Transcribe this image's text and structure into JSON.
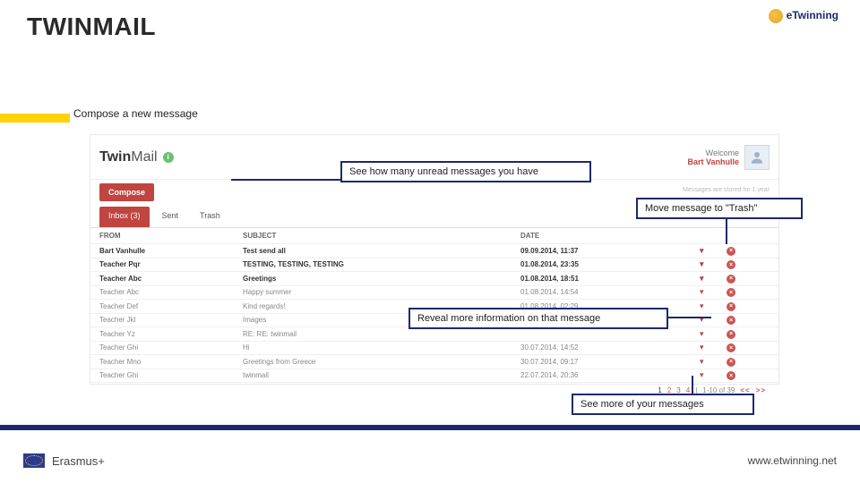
{
  "slide": {
    "title": "TWINMAIL"
  },
  "logo": {
    "text": "eTwinning"
  },
  "captions": {
    "compose": "Compose a new message",
    "unread": "See how many unread messages you have",
    "trash": "Move message to \"Trash\"",
    "reveal": "Reveal more information on that message",
    "seemore": "See more of your messages"
  },
  "app": {
    "title_prefix": "Twin",
    "title_suffix": "Mail",
    "welcome_label": "Welcome",
    "welcome_name": "Bart Vanhulle",
    "compose_label": "Compose",
    "storage_note": "Messages are stored for 1 year",
    "tabs": {
      "inbox": "Inbox (3)",
      "sent": "Sent",
      "trash": "Trash"
    },
    "columns": {
      "from": "FROM",
      "subject": "SUBJECT",
      "date": "DATE"
    },
    "rows": [
      {
        "from": "Bart Vanhulle",
        "subject": "Test send all",
        "date": "09.09.2014, 11:37",
        "bold": true
      },
      {
        "from": "Teacher Pqr",
        "subject": "TESTING, TESTING, TESTING",
        "date": "01.08.2014, 23:35",
        "bold": true
      },
      {
        "from": "Teacher Abc",
        "subject": "Greetings",
        "date": "01.08.2014, 18:51",
        "bold": true
      },
      {
        "from": "Teacher Abc",
        "subject": "Happy summer",
        "date": "01.08.2014, 14:54",
        "bold": false
      },
      {
        "from": "Teacher Def",
        "subject": "Kind regards!",
        "date": "01.08.2014, 02:29",
        "bold": false
      },
      {
        "from": "Teacher Jkl",
        "subject": "Images",
        "date": "",
        "bold": false
      },
      {
        "from": "Teacher Yz",
        "subject": "RE: RE: twinmail",
        "date": "",
        "bold": false
      },
      {
        "from": "Teacher Ghi",
        "subject": "Hi",
        "date": "30.07.2014, 14:52",
        "bold": false
      },
      {
        "from": "Teacher Mno",
        "subject": "Greetings from Greece",
        "date": "30.07.2014, 09:17",
        "bold": false
      },
      {
        "from": "Teacher Ghi",
        "subject": "twinmail",
        "date": "22.07.2014, 20:36",
        "bold": false
      }
    ],
    "pager": {
      "p1": "1",
      "p2": "2",
      "p3": "3",
      "p4": "4",
      "range": "1-10 of 39",
      "prev": "<<",
      "next": ">>"
    }
  },
  "footer": {
    "program": "Erasmus+",
    "url": "www.etwinning.net"
  }
}
